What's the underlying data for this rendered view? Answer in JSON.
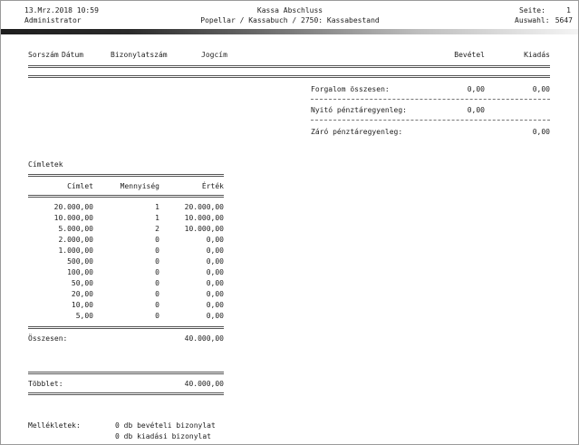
{
  "header": {
    "datetime": "13.Mrz.2018 10:59",
    "user": "Administrator",
    "title": "Kassa Abschluss",
    "subtitle": "Popellar / Kassabuch / 2750: Kassabestand",
    "page_label": "Seite:",
    "page_value": "1",
    "selection_label": "Auswahl:",
    "selection_value": "5647"
  },
  "columns": {
    "sorszam": "Sorszám",
    "datum": "Dátum",
    "bizonylatszam": "Bizonylatszám",
    "jogcim": "Jogcím",
    "bevetel": "Bevétel",
    "kiadas": "Kiadás"
  },
  "summary": {
    "forgalom_label": "Forgalom összesen:",
    "forgalom_bevetel": "0,00",
    "forgalom_kiadas": "0,00",
    "nyito_label": "Nyitó pénztáregyenleg:",
    "nyito_value": "0,00",
    "zaro_label": "Záró pénztáregyenleg:",
    "zaro_value": "0,00"
  },
  "cimletek": {
    "section_title": "Címletek",
    "headers": {
      "cimlet": "Címlet",
      "mennyiseg": "Mennyiség",
      "ertek": "Érték"
    },
    "rows": [
      {
        "cimlet": "20.000,00",
        "mennyiseg": "1",
        "ertek": "20.000,00"
      },
      {
        "cimlet": "10.000,00",
        "mennyiseg": "1",
        "ertek": "10.000,00"
      },
      {
        "cimlet": "5.000,00",
        "mennyiseg": "2",
        "ertek": "10.000,00"
      },
      {
        "cimlet": "2.000,00",
        "mennyiseg": "0",
        "ertek": "0,00"
      },
      {
        "cimlet": "1.000,00",
        "mennyiseg": "0",
        "ertek": "0,00"
      },
      {
        "cimlet": "500,00",
        "mennyiseg": "0",
        "ertek": "0,00"
      },
      {
        "cimlet": "100,00",
        "mennyiseg": "0",
        "ertek": "0,00"
      },
      {
        "cimlet": "50,00",
        "mennyiseg": "0",
        "ertek": "0,00"
      },
      {
        "cimlet": "20,00",
        "mennyiseg": "0",
        "ertek": "0,00"
      },
      {
        "cimlet": "10,00",
        "mennyiseg": "0",
        "ertek": "0,00"
      },
      {
        "cimlet": "5,00",
        "mennyiseg": "0",
        "ertek": "0,00"
      }
    ],
    "total_label": "Összesen:",
    "total_value": "40.000,00",
    "tobblet_label": "Többlet:",
    "tobblet_value": "40.000,00"
  },
  "mellekletek": {
    "label": "Mellékletek:",
    "line1": "0 db bevételi bizonylat",
    "line2": "0 db kiadási bizonylat"
  }
}
